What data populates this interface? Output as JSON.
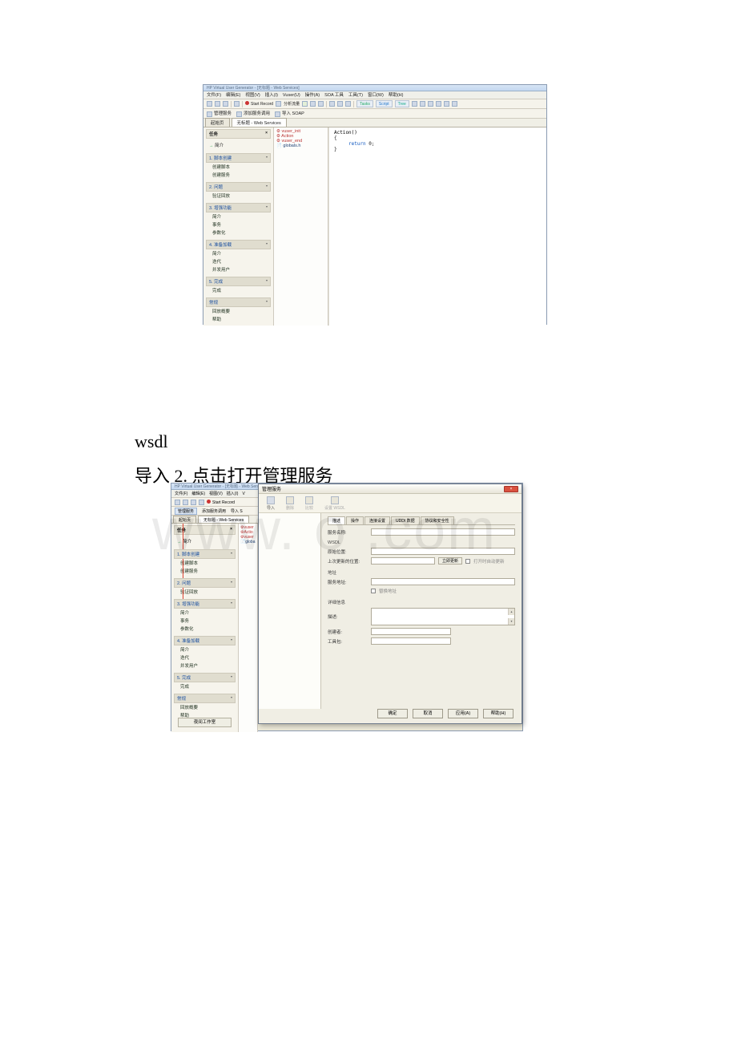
{
  "document": {
    "text_wsdl": "wsdl",
    "text_step": "导入 2. 点击打开管理服务",
    "watermark": "www.   o  .com"
  },
  "shot1": {
    "title": "HP Virtual User Generator - [无标题 - Web Services]",
    "menus": [
      "文件(F)",
      "编辑(E)",
      "视图(V)",
      "插入(I)",
      "Vuser(U)",
      "操作(A)",
      "SOA 工具",
      "工具(T)",
      "窗口(W)",
      "帮助(H)"
    ],
    "tb_start_record": "Start Record",
    "tb_analyze": "分析流量",
    "tb_tasks": "Tasks",
    "tb_script": "Script",
    "tb_tree": "Tree",
    "tb2_manage": "管理服务",
    "tb2_add": "添加服务调用",
    "tb2_import": "导入 SOAP",
    "tab_start": "起始页",
    "tab_active": "无标题 - Web Services",
    "side_header": "任务",
    "side_intro_arrow": "→",
    "side_intro": "简介",
    "sections": [
      {
        "num": "1.",
        "title": "脚本创建",
        "items": [
          "创建脚本",
          "创建服务"
        ]
      },
      {
        "num": "2.",
        "title": "问题",
        "items": [
          "验证回放"
        ]
      },
      {
        "num": "3.",
        "title": "增强功能",
        "items": [
          "简介",
          "事务",
          "参数化"
        ]
      },
      {
        "num": "4.",
        "title": "准备加载",
        "items": [
          "简介",
          "迭代",
          "并发用户"
        ]
      },
      {
        "num": "5.",
        "title": "完成",
        "items": [
          "完成"
        ]
      },
      {
        "num": "",
        "title": "常规",
        "items": [
          "回放概要",
          "帮助"
        ]
      }
    ],
    "files": [
      "vuser_init",
      "Action",
      "vuser_end",
      "globals.h"
    ],
    "code_line1": "Action()",
    "code_line2": "{",
    "code_line3_kw": "return",
    "code_line3_rest": " 0;",
    "code_line4": "}"
  },
  "shot2": {
    "title": "HP Virtual User Generator - [无标题 - Web Services]",
    "menus": [
      "文件(F)",
      "编辑(E)",
      "视图(V)",
      "插入(I)",
      "V"
    ],
    "tb_start_record": "Start Record",
    "tb2_manage": "管理服务",
    "tb2_add": "添加服务调用",
    "tb2_import": "导入 S",
    "tab_start": "起始页",
    "tab_active": "无标题 - Web Services",
    "side_header": "任务",
    "side_intro": "简介",
    "sections": [
      {
        "num": "1.",
        "title": "脚本创建",
        "items": [
          "创建脚本",
          "创建服务"
        ]
      },
      {
        "num": "2.",
        "title": "问题",
        "items": [
          "验证回放"
        ]
      },
      {
        "num": "3.",
        "title": "增强功能",
        "items": [
          "简介",
          "事务",
          "参数化"
        ]
      },
      {
        "num": "4.",
        "title": "准备加载",
        "items": [
          "简介",
          "迭代",
          "并发用户"
        ]
      },
      {
        "num": "5.",
        "title": "完成",
        "items": [
          "完成"
        ]
      },
      {
        "num": "",
        "title": "常规",
        "items": [
          "回放概要",
          "帮助"
        ]
      }
    ],
    "bottom_btn": "夜间工作室",
    "files": [
      "vuser",
      "Actio",
      "vuser",
      "globa"
    ]
  },
  "dialog": {
    "title": "管理服务",
    "close_x": "×",
    "tb": [
      {
        "label": "导入"
      },
      {
        "label": "删除"
      },
      {
        "label": "比较"
      },
      {
        "label": "设置 WSDL"
      }
    ],
    "tabs": [
      "描述",
      "操作",
      "连接设置",
      "UDDI 数据",
      "协议和安全性"
    ],
    "lbl_service_name": "服务名称:",
    "sec_wsdl": "WSDL",
    "lbl_orig_loc": "原始位置:",
    "lbl_last_update": "上次更新的位置:",
    "btn_update_now": "立即更新",
    "chk_update_label": "打开时自动更新",
    "sec_addr": "地址",
    "lbl_service_addr": "服务地址:",
    "chk_override": "替换地址",
    "sec_detail": "详细信息",
    "lbl_desc": "描述:",
    "lbl_creator": "创建者:",
    "lbl_toolkit": "工具包:",
    "btns": [
      "确定",
      "取消",
      "应用(A)",
      "帮助(H)"
    ]
  }
}
